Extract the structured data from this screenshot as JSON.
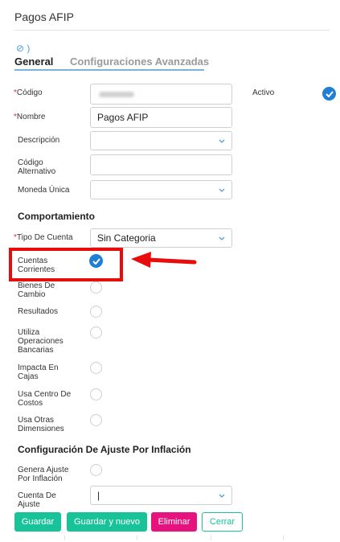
{
  "window": {
    "title": "Pagos AFIP"
  },
  "header": {
    "tag_glyph": "⊘ )"
  },
  "tabs": [
    {
      "label": "General",
      "active": true
    },
    {
      "label": "Configuraciones Avanzadas",
      "active": false
    }
  ],
  "form": {
    "codigo": {
      "label": "Código",
      "required": true,
      "value_visible": false
    },
    "activo": {
      "label": "Activo",
      "checked": true
    },
    "nombre": {
      "label": "Nombre",
      "required": true,
      "value": "Pagos AFIP"
    },
    "descripcion": {
      "label": "Descripción",
      "value": ""
    },
    "codigo_alternativo": {
      "label_line1": "Código",
      "label_line2": "Alternativo",
      "value": ""
    },
    "moneda_unica": {
      "label": "Moneda Única",
      "value": ""
    }
  },
  "comportamiento": {
    "title": "Comportamiento",
    "tipo_de_cuenta": {
      "label": "Tipo De Cuenta",
      "required": true,
      "value": "Sin Categoria"
    },
    "options": [
      {
        "label_lines": [
          "Cuentas",
          "Corrientes"
        ],
        "checked": true
      },
      {
        "label_lines": [
          "Bienes De",
          "Cambio"
        ],
        "checked": false
      },
      {
        "label_lines": [
          "Resultados"
        ],
        "checked": false
      },
      {
        "label_lines": [
          "Utiliza",
          "Operaciones",
          "Bancarias"
        ],
        "checked": false
      },
      {
        "label_lines": [
          "Impacta En",
          "Cajas"
        ],
        "checked": false
      },
      {
        "label_lines": [
          "Usa Centro De",
          "Costos"
        ],
        "checked": false
      },
      {
        "label_lines": [
          "Usa Otras",
          "Dimensiones"
        ],
        "checked": false
      }
    ]
  },
  "ajuste": {
    "title": "Configuración De Ajuste Por Inflación",
    "genera": {
      "label_lines": [
        "Genera Ajuste",
        "Por Inflación"
      ],
      "checked": false
    },
    "cuenta": {
      "label_lines": [
        "Cuenta De",
        "Ajuste"
      ],
      "value": "|"
    }
  },
  "buttons": {
    "guardar": "Guardar",
    "guardar_y_nuevo": "Guardar y nuevo",
    "eliminar": "Eliminar",
    "cerrar": "Cerrar"
  },
  "colors": {
    "accent_blue": "#1f7fd4",
    "green": "#19c39a",
    "pink": "#e6137f",
    "highlight_red": "#e80c0c"
  }
}
